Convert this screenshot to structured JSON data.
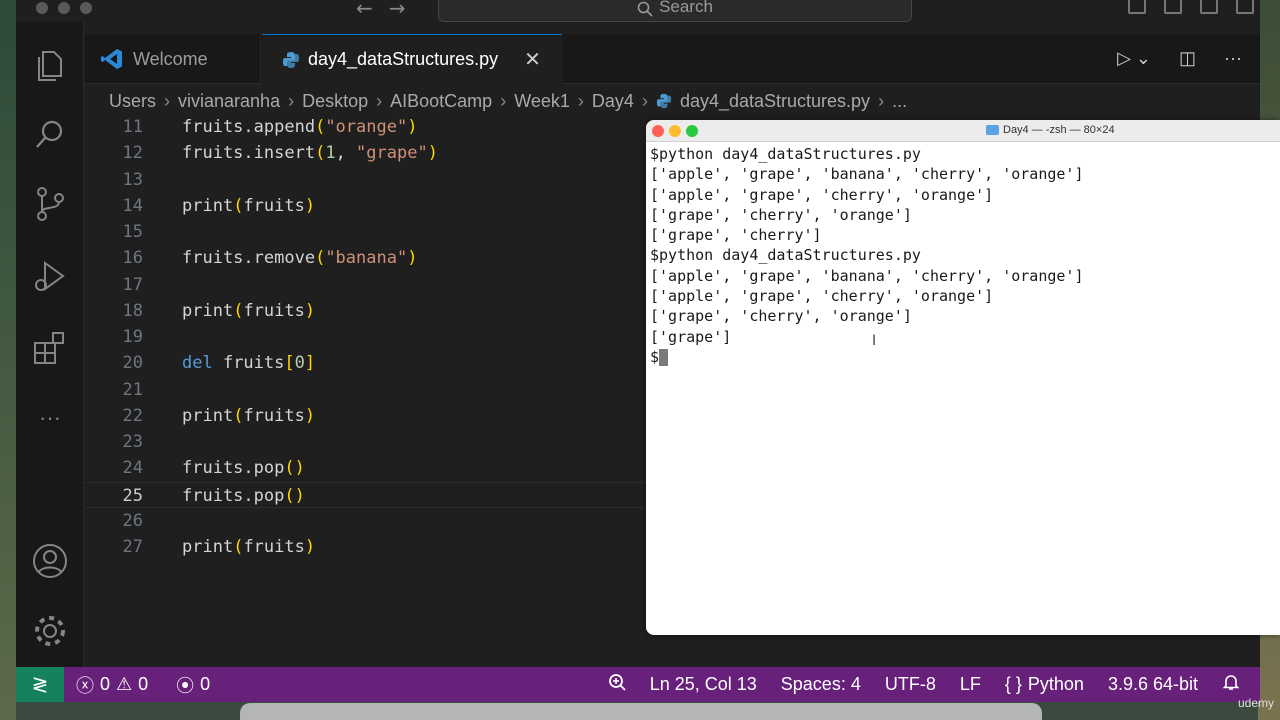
{
  "window": {
    "search_placeholder": "Search"
  },
  "tabs": [
    {
      "label": "Welcome"
    },
    {
      "label": "day4_dataStructures.py"
    }
  ],
  "breadcrumb": [
    "Users",
    "vivianaranha",
    "Desktop",
    "AIBootCamp",
    "Week1",
    "Day4",
    "day4_dataStructures.py",
    "..."
  ],
  "editor": {
    "current_line": 25,
    "lines": [
      {
        "n": "11",
        "text": "fruits.append(\"orange\")"
      },
      {
        "n": "12",
        "text": "fruits.insert(1, \"grape\")"
      },
      {
        "n": "13",
        "text": ""
      },
      {
        "n": "14",
        "text": "print(fruits)"
      },
      {
        "n": "15",
        "text": ""
      },
      {
        "n": "16",
        "text": "fruits.remove(\"banana\")"
      },
      {
        "n": "17",
        "text": ""
      },
      {
        "n": "18",
        "text": "print(fruits)"
      },
      {
        "n": "19",
        "text": ""
      },
      {
        "n": "20",
        "text": "del fruits[0]"
      },
      {
        "n": "21",
        "text": ""
      },
      {
        "n": "22",
        "text": "print(fruits)"
      },
      {
        "n": "23",
        "text": ""
      },
      {
        "n": "24",
        "text": "fruits.pop()"
      },
      {
        "n": "25",
        "text": "fruits.pop()"
      },
      {
        "n": "26",
        "text": ""
      },
      {
        "n": "27",
        "text": "print(fruits)"
      }
    ]
  },
  "terminal": {
    "title": "Day4 — -zsh — 80×24",
    "lines": [
      "$python day4_dataStructures.py",
      "['apple', 'grape', 'banana', 'cherry', 'orange']",
      "['apple', 'grape', 'cherry', 'orange']",
      "['grape', 'cherry', 'orange']",
      "['grape', 'cherry']",
      "$python day4_dataStructures.py",
      "['apple', 'grape', 'banana', 'cherry', 'orange']",
      "['apple', 'grape', 'cherry', 'orange']",
      "['grape', 'cherry', 'orange']",
      "['grape']"
    ],
    "prompt": "$"
  },
  "status": {
    "errors": "0",
    "warnings": "0",
    "ports": "0",
    "position": "Ln 25, Col 13",
    "spaces": "Spaces: 4",
    "encoding": "UTF-8",
    "eol": "LF",
    "language_icon": "{ }",
    "language": "Python",
    "interpreter": "3.9.6 64-bit"
  },
  "watermark": "udemy",
  "colors": {
    "statusbar": "#68217a",
    "remote": "#16825d",
    "accent": "#0078d4"
  }
}
